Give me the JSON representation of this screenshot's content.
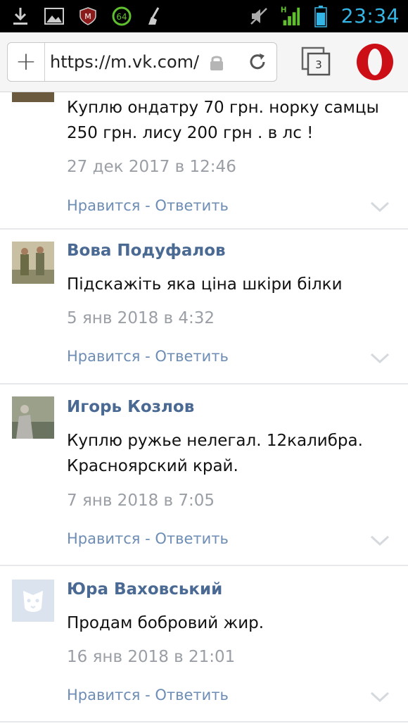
{
  "status_bar": {
    "time": "23:34",
    "battery_level": 0.7,
    "icons": [
      "download-icon",
      "image-icon",
      "shield-icon",
      "battery-64-icon",
      "broom-icon",
      "mute-icon",
      "signal-icon",
      "battery-icon"
    ],
    "badge_64": "64",
    "network_label": "H"
  },
  "browser": {
    "add_label": "+",
    "url": "https://m.vk.com/",
    "tabs_count": "3",
    "accent": "#cc0f16"
  },
  "comments": [
    {
      "author": "",
      "text": "Куплю ондатру 70 грн. норку самцы 250 грн. лису 200 грн . в лс !",
      "date": "27 дек 2017 в 12:46",
      "like": "Нравится",
      "separator": " - ",
      "reply": "Ответить"
    },
    {
      "author": "Вова Подуфалов",
      "text": "Підскажіть яка ціна шкіри білки",
      "date": "5 янв 2018 в 4:32",
      "like": "Нравится",
      "separator": " - ",
      "reply": "Ответить"
    },
    {
      "author": "Игорь Козлов",
      "text": "Куплю ружье нелегал. 12калибра. Красноярский край.",
      "date": "7 янв 2018 в 7:05",
      "like": "Нравится",
      "separator": " - ",
      "reply": "Ответить"
    },
    {
      "author": "Юра Ваховський",
      "text": "Продам бобровий жир.",
      "date": "16 янв 2018 в 21:01",
      "like": "Нравится",
      "separator": " - ",
      "reply": "Ответить"
    }
  ]
}
